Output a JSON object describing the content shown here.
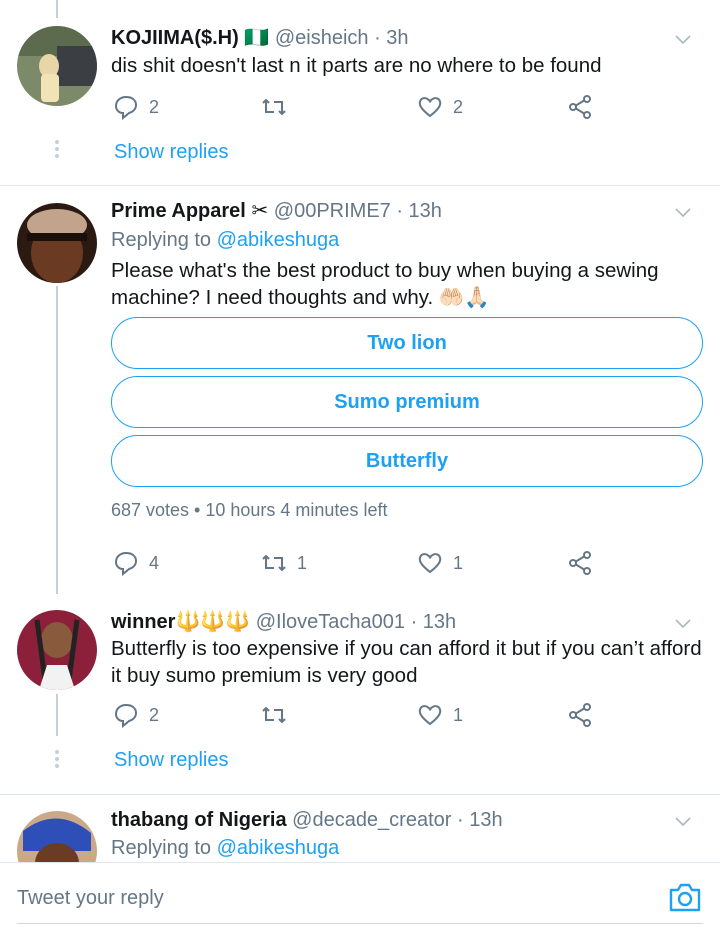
{
  "tweets": [
    {
      "name": "KOJIIMA($.H)",
      "flag": "🇳🇬",
      "handle": "@eisheich",
      "time": "· 3h",
      "text": "dis shit doesn't last n it parts are no where to be found",
      "replies": "2",
      "retweets": "",
      "likes": "2",
      "show_replies": "Show replies"
    },
    {
      "name": "Prime Apparel",
      "name_emoji": "✂",
      "handle": "@00PRIME7",
      "time": "· 13h",
      "replying_prefix": "Replying to",
      "replying_to": "@abikeshuga",
      "text": "Please what's the best product to buy when buying a sewing machine? I need thoughts and why. 🤲🏻🙏🏻",
      "poll": {
        "options": [
          "Two lion",
          "Sumo premium",
          "Butterfly"
        ],
        "meta": "687 votes • 10 hours 4 minutes left"
      },
      "replies": "4",
      "retweets": "1",
      "likes": "1"
    },
    {
      "name": "winner",
      "name_emoji": "🔱🔱🔱",
      "handle": "@IloveTacha001",
      "time": "· 13h",
      "text": "Butterfly is too expensive if you can afford it but if you can’t afford it buy sumo premium is very good",
      "replies": "2",
      "retweets": "",
      "likes": "1",
      "show_replies": "Show replies"
    },
    {
      "name": "thabang of Nigeria",
      "handle": "@decade_creator",
      "time": "· 13h",
      "replying_prefix": "Replying to",
      "replying_to": "@abikeshuga"
    }
  ],
  "composer": {
    "placeholder": "Tweet your reply"
  },
  "colors": {
    "accent": "#1da1f2",
    "secondary_text": "#657786",
    "primary_text": "#14171a",
    "divider": "#e1e8ed"
  },
  "icons": [
    "reply-icon",
    "retweet-icon",
    "like-icon",
    "share-icon",
    "caret-down-icon",
    "camera-icon"
  ]
}
